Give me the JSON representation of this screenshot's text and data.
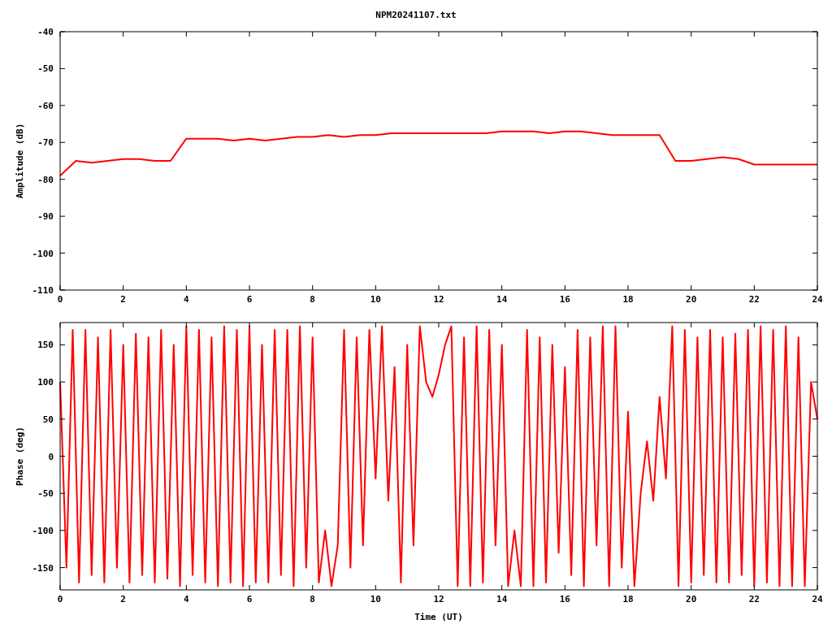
{
  "title": "NPM20241107.txt",
  "charts": [
    {
      "chart_data": {
        "type": "line",
        "ylabel": "Amplitude (dB)",
        "xlim": [
          0,
          24
        ],
        "ylim": [
          -110,
          -40
        ],
        "xticks": [
          0,
          2,
          4,
          6,
          8,
          10,
          12,
          14,
          16,
          18,
          20,
          22,
          24
        ],
        "yticks": [
          -110,
          -100,
          -90,
          -80,
          -70,
          -60,
          -50,
          -40
        ],
        "x": [
          0,
          0.5,
          1,
          1.5,
          2,
          2.5,
          3,
          3.5,
          4,
          4.5,
          5,
          5.5,
          6,
          6.5,
          7,
          7.5,
          8,
          8.5,
          9,
          9.5,
          10,
          10.5,
          11,
          11.5,
          12,
          12.5,
          13,
          13.5,
          14,
          14.5,
          15,
          15.5,
          16,
          16.5,
          17,
          17.5,
          18,
          18.5,
          19,
          19.5,
          20,
          20.5,
          21,
          21.5,
          22,
          22.5,
          23,
          23.5,
          24
        ],
        "series": [
          {
            "color": "#ff0000",
            "values": [
              -79,
              -75,
              -75.5,
              -75,
              -74.5,
              -74.5,
              -75,
              -75,
              -69,
              -69,
              -69,
              -69.5,
              -69,
              -69.5,
              -69,
              -68.5,
              -68.5,
              -68,
              -68.5,
              -68,
              -68,
              -67.5,
              -67.5,
              -67.5,
              -67.5,
              -67.5,
              -67.5,
              -67.5,
              -67,
              -67,
              -67,
              -67.5,
              -67,
              -67,
              -67.5,
              -68,
              -68,
              -68,
              -68,
              -75,
              -75,
              -74.5,
              -74,
              -74.5,
              -76,
              -76,
              -76,
              -76,
              -76
            ]
          }
        ]
      }
    },
    {
      "chart_data": {
        "type": "line",
        "xlabel": "Time (UT)",
        "ylabel": "Phase (deg)",
        "xlim": [
          0,
          24
        ],
        "ylim": [
          -180,
          180
        ],
        "xticks": [
          0,
          2,
          4,
          6,
          8,
          10,
          12,
          14,
          16,
          18,
          20,
          22,
          24
        ],
        "yticks": [
          -150,
          -100,
          -50,
          0,
          50,
          100,
          150
        ],
        "x": [
          0,
          0.2,
          0.4,
          0.6,
          0.8,
          1,
          1.2,
          1.4,
          1.6,
          1.8,
          2,
          2.2,
          2.4,
          2.6,
          2.8,
          3,
          3.2,
          3.4,
          3.6,
          3.8,
          4,
          4.2,
          4.4,
          4.6,
          4.8,
          5,
          5.2,
          5.4,
          5.6,
          5.8,
          6,
          6.2,
          6.4,
          6.6,
          6.8,
          7,
          7.2,
          7.4,
          7.6,
          7.8,
          8,
          8.2,
          8.4,
          8.6,
          8.8,
          9,
          9.2,
          9.4,
          9.6,
          9.8,
          10,
          10.2,
          10.4,
          10.6,
          10.8,
          11,
          11.2,
          11.4,
          11.6,
          11.8,
          12,
          12.2,
          12.4,
          12.6,
          12.8,
          13,
          13.2,
          13.4,
          13.6,
          13.8,
          14,
          14.2,
          14.4,
          14.6,
          14.8,
          15,
          15.2,
          15.4,
          15.6,
          15.8,
          16,
          16.2,
          16.4,
          16.6,
          16.8,
          17,
          17.2,
          17.4,
          17.6,
          17.8,
          18,
          18.2,
          18.4,
          18.6,
          18.8,
          19,
          19.2,
          19.4,
          19.6,
          19.8,
          20,
          20.2,
          20.4,
          20.6,
          20.8,
          21,
          21.2,
          21.4,
          21.6,
          21.8,
          22,
          22.2,
          22.4,
          22.6,
          22.8,
          23,
          23.2,
          23.4,
          23.6,
          23.8,
          24
        ],
        "series": [
          {
            "color": "#ff0000",
            "values": [
              100,
              -150,
              170,
              -170,
              170,
              -160,
              160,
              -170,
              170,
              -150,
              150,
              -170,
              165,
              -160,
              160,
              -170,
              170,
              -165,
              150,
              -175,
              175,
              -160,
              170,
              -170,
              160,
              -175,
              175,
              -170,
              170,
              -175,
              175,
              -170,
              150,
              -170,
              170,
              -160,
              170,
              -175,
              175,
              -150,
              160,
              -170,
              -100,
              -175,
              -120,
              170,
              -150,
              160,
              -120,
              170,
              -30,
              175,
              -60,
              120,
              -170,
              150,
              -120,
              175,
              100,
              80,
              110,
              150,
              175,
              -175,
              160,
              -175,
              175,
              -170,
              170,
              -120,
              150,
              -175,
              -100,
              -175,
              170,
              -175,
              160,
              -170,
              150,
              -130,
              120,
              -160,
              170,
              -175,
              160,
              -120,
              175,
              -175,
              175,
              -150,
              60,
              -175,
              -50,
              20,
              -60,
              80,
              -30,
              175,
              -175,
              170,
              -170,
              160,
              -160,
              170,
              -170,
              160,
              -170,
              165,
              -160,
              170,
              -175,
              175,
              -170,
              170,
              -175,
              175,
              -175,
              160,
              -175,
              100,
              50
            ]
          }
        ]
      }
    }
  ]
}
